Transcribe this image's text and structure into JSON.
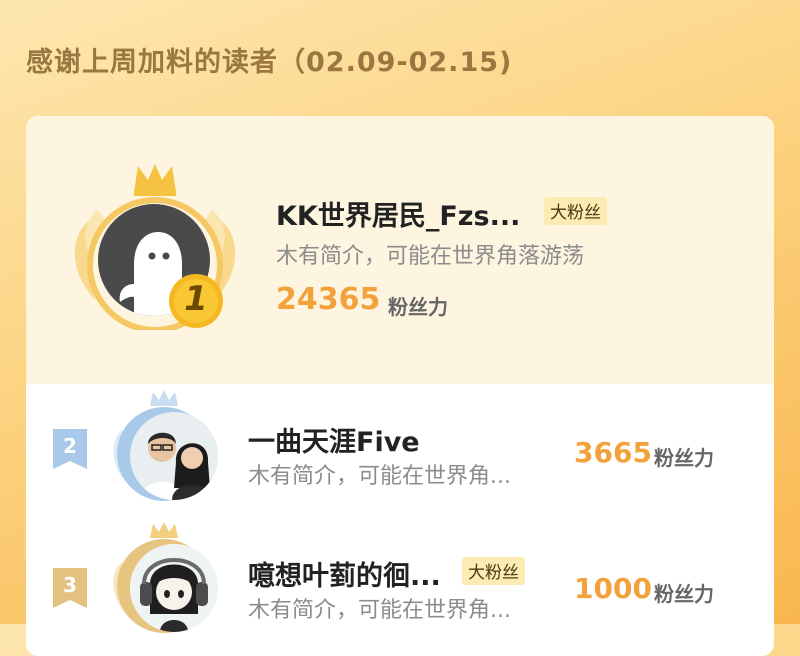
{
  "header": {
    "title": "感谢上周加料的读者（02.09-02.15)"
  },
  "fans_power_label": "粉丝力",
  "readers": [
    {
      "rank": "1",
      "name": "KK世界居民_Fzs...",
      "tag": "大粉丝",
      "bio": "木有简介，可能在世界角落游荡",
      "fans": "24365"
    },
    {
      "rank": "2",
      "name": "一曲天涯Five",
      "tag": "",
      "bio": "木有简介，可能在世界角...",
      "fans": "3665"
    },
    {
      "rank": "3",
      "name": "噫想叶菿的徊...",
      "tag": "大粉丝",
      "bio": "木有简介，可能在世界角...",
      "fans": "1000"
    }
  ],
  "colors": {
    "gold": "#f3a13a",
    "silver": "#9ec3e6",
    "bronze": "#e3c27f"
  }
}
